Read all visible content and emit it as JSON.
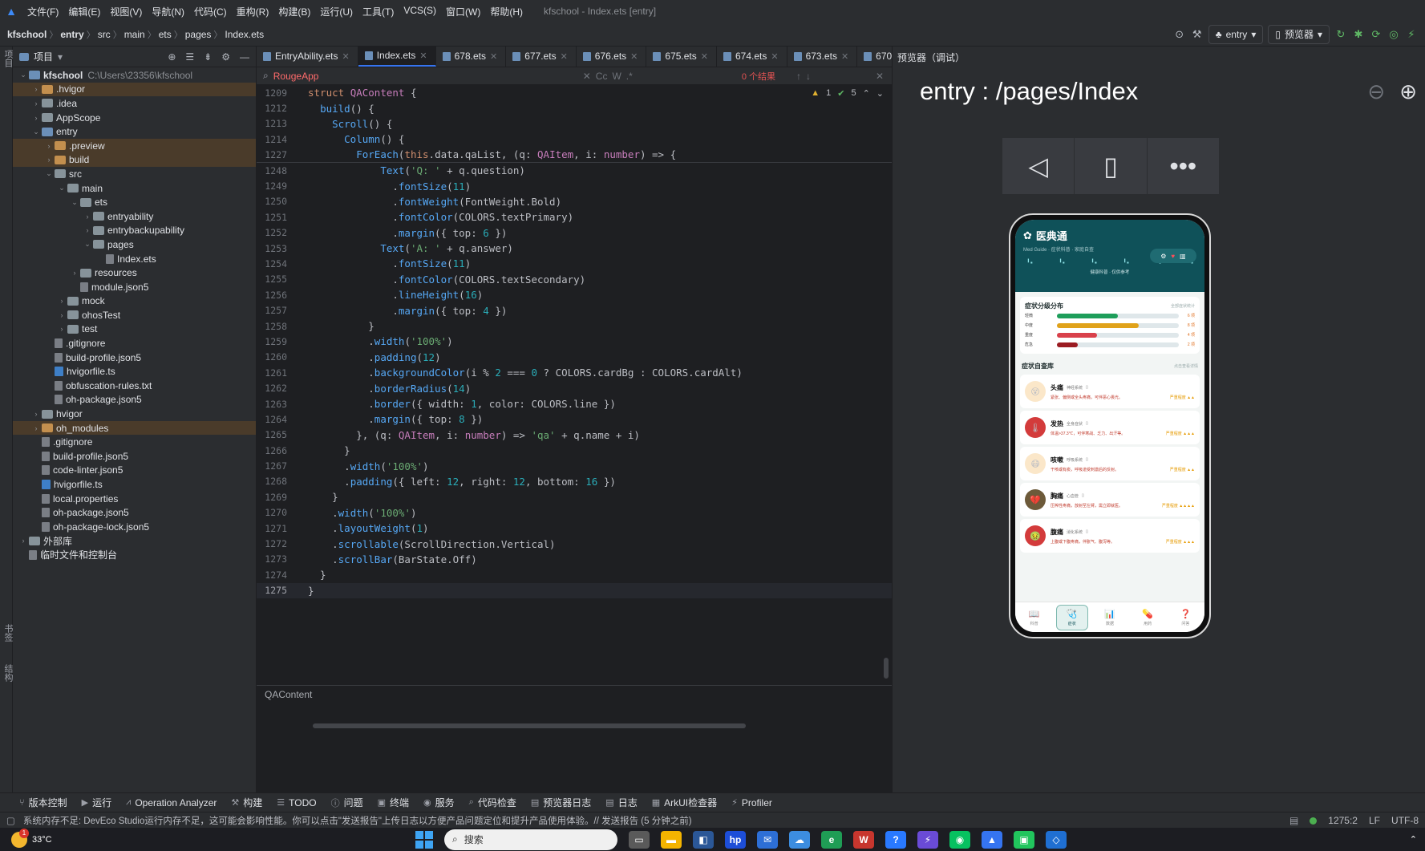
{
  "menubar": {
    "items": [
      "文件(F)",
      "编辑(E)",
      "视图(V)",
      "导航(N)",
      "代码(C)",
      "重构(R)",
      "构建(B)",
      "运行(U)",
      "工具(T)",
      "VCS(S)",
      "窗口(W)",
      "帮助(H)"
    ],
    "window_title": "kfschool - Index.ets [entry]"
  },
  "navbar": {
    "crumbs": [
      "kfschool",
      "entry",
      "src",
      "main",
      "ets",
      "pages",
      "Index.ets"
    ],
    "run_config": "entry",
    "previewer": "预览器"
  },
  "left_strip": {
    "top_label": "项目",
    "bottom_label_1": "书签",
    "bottom_label_2": "结构"
  },
  "project": {
    "header": "项目",
    "tree": [
      {
        "label": "kfschool",
        "path": "C:\\Users\\23356\\kfschool",
        "indent": 0,
        "arrow": "down",
        "icon": "folder-b",
        "bold": true
      },
      {
        "label": ".hvigor",
        "indent": 1,
        "arrow": "right",
        "icon": "folder-o",
        "hl": true
      },
      {
        "label": ".idea",
        "indent": 1,
        "arrow": "right",
        "icon": "folder"
      },
      {
        "label": "AppScope",
        "indent": 1,
        "arrow": "right",
        "icon": "folder"
      },
      {
        "label": "entry",
        "indent": 1,
        "arrow": "down",
        "icon": "folder-b"
      },
      {
        "label": ".preview",
        "indent": 2,
        "arrow": "right",
        "icon": "folder-o",
        "hl": true
      },
      {
        "label": "build",
        "indent": 2,
        "arrow": "right",
        "icon": "folder-o",
        "hl": true
      },
      {
        "label": "src",
        "indent": 2,
        "arrow": "down",
        "icon": "folder"
      },
      {
        "label": "main",
        "indent": 3,
        "arrow": "down",
        "icon": "folder"
      },
      {
        "label": "ets",
        "indent": 4,
        "arrow": "down",
        "icon": "folder"
      },
      {
        "label": "entryability",
        "indent": 5,
        "arrow": "right",
        "icon": "folder"
      },
      {
        "label": "entrybackupability",
        "indent": 5,
        "arrow": "right",
        "icon": "folder"
      },
      {
        "label": "pages",
        "indent": 5,
        "arrow": "down",
        "icon": "folder"
      },
      {
        "label": "Index.ets",
        "indent": 6,
        "arrow": "",
        "icon": "file"
      },
      {
        "label": "resources",
        "indent": 4,
        "arrow": "right",
        "icon": "folder"
      },
      {
        "label": "module.json5",
        "indent": 4,
        "arrow": "",
        "icon": "file"
      },
      {
        "label": "mock",
        "indent": 3,
        "arrow": "right",
        "icon": "folder"
      },
      {
        "label": "ohosTest",
        "indent": 3,
        "arrow": "right",
        "icon": "folder"
      },
      {
        "label": "test",
        "indent": 3,
        "arrow": "right",
        "icon": "folder"
      },
      {
        "label": ".gitignore",
        "indent": 2,
        "arrow": "",
        "icon": "file"
      },
      {
        "label": "build-profile.json5",
        "indent": 2,
        "arrow": "",
        "icon": "file"
      },
      {
        "label": "hvigorfile.ts",
        "indent": 2,
        "arrow": "",
        "icon": "ts"
      },
      {
        "label": "obfuscation-rules.txt",
        "indent": 2,
        "arrow": "",
        "icon": "file"
      },
      {
        "label": "oh-package.json5",
        "indent": 2,
        "arrow": "",
        "icon": "file"
      },
      {
        "label": "hvigor",
        "indent": 1,
        "arrow": "right",
        "icon": "folder"
      },
      {
        "label": "oh_modules",
        "indent": 1,
        "arrow": "right",
        "icon": "folder-o",
        "hl": true
      },
      {
        "label": ".gitignore",
        "indent": 1,
        "arrow": "",
        "icon": "file"
      },
      {
        "label": "build-profile.json5",
        "indent": 1,
        "arrow": "",
        "icon": "file"
      },
      {
        "label": "code-linter.json5",
        "indent": 1,
        "arrow": "",
        "icon": "file"
      },
      {
        "label": "hvigorfile.ts",
        "indent": 1,
        "arrow": "",
        "icon": "ts"
      },
      {
        "label": "local.properties",
        "indent": 1,
        "arrow": "",
        "icon": "file"
      },
      {
        "label": "oh-package.json5",
        "indent": 1,
        "arrow": "",
        "icon": "file"
      },
      {
        "label": "oh-package-lock.json5",
        "indent": 1,
        "arrow": "",
        "icon": "file"
      },
      {
        "label": "外部库",
        "indent": 0,
        "arrow": "right",
        "icon": "folder"
      },
      {
        "label": "临时文件和控制台",
        "indent": 0,
        "arrow": "",
        "icon": "file"
      }
    ]
  },
  "editor": {
    "tabs": [
      {
        "label": "EntryAbility.ets",
        "active": false
      },
      {
        "label": "Index.ets",
        "active": true
      },
      {
        "label": "678.ets",
        "active": false
      },
      {
        "label": "677.ets",
        "active": false
      },
      {
        "label": "676.ets",
        "active": false
      },
      {
        "label": "675.ets",
        "active": false
      },
      {
        "label": "674.ets",
        "active": false
      },
      {
        "label": "673.ets",
        "active": false
      },
      {
        "label": "670",
        "active": false
      }
    ],
    "find_query": "RougeApp",
    "find_results": "0 个结果",
    "inspections": {
      "warnings": "1",
      "ok": "5"
    },
    "bottom_breadcrumb": "QAContent",
    "lines": [
      {
        "n": "1209",
        "html": "<span class='k'>struct</span> <span class='t'>QAContent</span> <span class='p'>{</span>"
      },
      {
        "n": "1212",
        "html": "  <span class='f'>build</span>() {"
      },
      {
        "n": "1213",
        "html": "    <span class='f'>Scroll</span>() {"
      },
      {
        "n": "1214",
        "html": "      <span class='f'>Column</span>() {"
      },
      {
        "n": "1227",
        "html": "        <span class='f'>ForEach</span>(<span class='k'>this</span>.data.qaList, (q: <span class='t'>QAItem</span>, i: <span class='t'>number</span>) => {",
        "sticky": true
      },
      {
        "n": "1248",
        "html": "            <span class='f'>Text</span>(<span class='s'>'Q: '</span> + q.question)"
      },
      {
        "n": "1249",
        "html": "              .<span class='f'>fontSize</span>(<span class='n'>11</span>)"
      },
      {
        "n": "1250",
        "html": "              .<span class='f'>fontWeight</span>(FontWeight.Bold)"
      },
      {
        "n": "1251",
        "html": "              .<span class='f'>fontColor</span>(COLORS.textPrimary)"
      },
      {
        "n": "1252",
        "html": "              .<span class='f'>margin</span>({ top: <span class='n'>6</span> })"
      },
      {
        "n": "1253",
        "html": "            <span class='f'>Text</span>(<span class='s'>'A: '</span> + q.answer)"
      },
      {
        "n": "1254",
        "html": "              .<span class='f'>fontSize</span>(<span class='n'>11</span>)"
      },
      {
        "n": "1255",
        "html": "              .<span class='f'>fontColor</span>(COLORS.textSecondary)"
      },
      {
        "n": "1256",
        "html": "              .<span class='f'>lineHeight</span>(<span class='n'>16</span>)"
      },
      {
        "n": "1257",
        "html": "              .<span class='f'>margin</span>({ top: <span class='n'>4</span> })"
      },
      {
        "n": "1258",
        "html": "          }"
      },
      {
        "n": "1259",
        "html": "          .<span class='f'>width</span>(<span class='s'>'100%'</span>)"
      },
      {
        "n": "1260",
        "html": "          .<span class='f'>padding</span>(<span class='n'>12</span>)"
      },
      {
        "n": "1261",
        "html": "          .<span class='f'>backgroundColor</span>(i % <span class='n'>2</span> === <span class='n'>0</span> ? COLORS.cardBg : COLORS.cardAlt)"
      },
      {
        "n": "1262",
        "html": "          .<span class='f'>borderRadius</span>(<span class='n'>14</span>)"
      },
      {
        "n": "1263",
        "html": "          .<span class='f'>border</span>({ width: <span class='n'>1</span>, color: COLORS.line })"
      },
      {
        "n": "1264",
        "html": "          .<span class='f'>margin</span>({ top: <span class='n'>8</span> })"
      },
      {
        "n": "1265",
        "html": "        }, (q: <span class='t'>QAItem</span>, i: <span class='t'>number</span>) => <span class='s'>'qa'</span> + q.name + i)"
      },
      {
        "n": "1266",
        "html": "      }"
      },
      {
        "n": "1267",
        "html": "      .<span class='f'>width</span>(<span class='s'>'100%'</span>)"
      },
      {
        "n": "1268",
        "html": "      .<span class='f'>padding</span>({ left: <span class='n'>12</span>, right: <span class='n'>12</span>, bottom: <span class='n'>16</span> })"
      },
      {
        "n": "1269",
        "html": "    }"
      },
      {
        "n": "1270",
        "html": "    .<span class='f'>width</span>(<span class='s'>'100%'</span>)"
      },
      {
        "n": "1271",
        "html": "    .<span class='f'>layoutWeight</span>(<span class='n'>1</span>)"
      },
      {
        "n": "1272",
        "html": "    .<span class='f'>scrollable</span>(ScrollDirection.Vertical)"
      },
      {
        "n": "1273",
        "html": "    .<span class='f'>scrollBar</span>(BarState.Off)"
      },
      {
        "n": "1274",
        "html": "  }"
      },
      {
        "n": "1275",
        "html": "}",
        "current": true
      }
    ]
  },
  "preview": {
    "header": "预览器（调试）",
    "route": "entry : /pages/Index",
    "app": {
      "title": "医典通",
      "subtitle": "Med Guide · 症状科普 · 家庭自查",
      "tagline": "健康科普 · 仅供参考",
      "severity_title": "症状分级分布",
      "severity_more": "全部症状统计",
      "severity": [
        {
          "label": "轻微",
          "value": 0.5,
          "count": "6 项",
          "color": "#1e9e5a"
        },
        {
          "label": "中度",
          "value": 0.67,
          "count": "8 项",
          "color": "#e0a21a"
        },
        {
          "label": "重度",
          "value": 0.33,
          "count": "4 项",
          "color": "#d9414b"
        },
        {
          "label": "危急",
          "value": 0.17,
          "count": "2 项",
          "color": "#9b1c22"
        }
      ],
      "library_title": "症状自查库",
      "library_more": "点击查看详情",
      "symptoms": [
        {
          "name": "头痛",
          "tag": "神经系统",
          "desc": "紧张、偏侧或全头疼痛，可伴恶心畏光。",
          "sev": "严重程度 ▲▲",
          "icon": "😵",
          "bg": "#fbe7c9"
        },
        {
          "name": "发热",
          "tag": "全身症状",
          "desc": "体温>37.3℃，可伴寒战、乏力、出汗等。",
          "sev": "严重程度 ▲▲▲",
          "icon": "🌡",
          "bg": "#d33b3b"
        },
        {
          "name": "咳嗽",
          "tag": "呼吸系统",
          "desc": "干咳或有痰，呼吸道受刺激后的反射。",
          "sev": "严重程度 ▲▲",
          "icon": "😷",
          "bg": "#fbe7c9"
        },
        {
          "name": "胸痛",
          "tag": "心血管",
          "desc": "压榨性疼痛，放射至左臂，需立即就医。",
          "sev": "严重程度 ▲▲▲▲",
          "icon": "💔",
          "bg": "#6d5a3a"
        },
        {
          "name": "腹痛",
          "tag": "消化系统",
          "desc": "上腹或下腹疼痛，伴胀气、腹泻等。",
          "sev": "严重程度 ▲▲▲",
          "icon": "🤢",
          "bg": "#d33b3b"
        }
      ],
      "tabbar": [
        {
          "label": "科普",
          "icon": "📖",
          "active": false
        },
        {
          "label": "症状",
          "icon": "🩺",
          "active": true
        },
        {
          "label": "数据",
          "icon": "📊",
          "active": false
        },
        {
          "label": "用药",
          "icon": "💊",
          "active": false
        },
        {
          "label": "问答",
          "icon": "❓",
          "active": false
        }
      ]
    }
  },
  "bottom_tools": [
    "版本控制",
    "运行",
    "Operation Analyzer",
    "构建",
    "TODO",
    "问题",
    "终端",
    "服务",
    "代码检查",
    "预览器日志",
    "日志",
    "ArkUI检查器",
    "Profiler"
  ],
  "statusbar": {
    "message": "系统内存不足: DevEco Studio运行内存不足，这可能会影响性能。你可以点击\"发送报告\"上传日志以方便产品问题定位和提升产品使用体验。// 发送报告 (5 分钟之前)",
    "position": "1275:2",
    "line_sep": "LF",
    "encoding": "UTF-8"
  },
  "taskbar": {
    "temperature": "33°C",
    "weather_badge": "1",
    "search_placeholder": "搜索"
  },
  "colors": {
    "accent": "#3574f0",
    "app_header": "#0f5159"
  }
}
